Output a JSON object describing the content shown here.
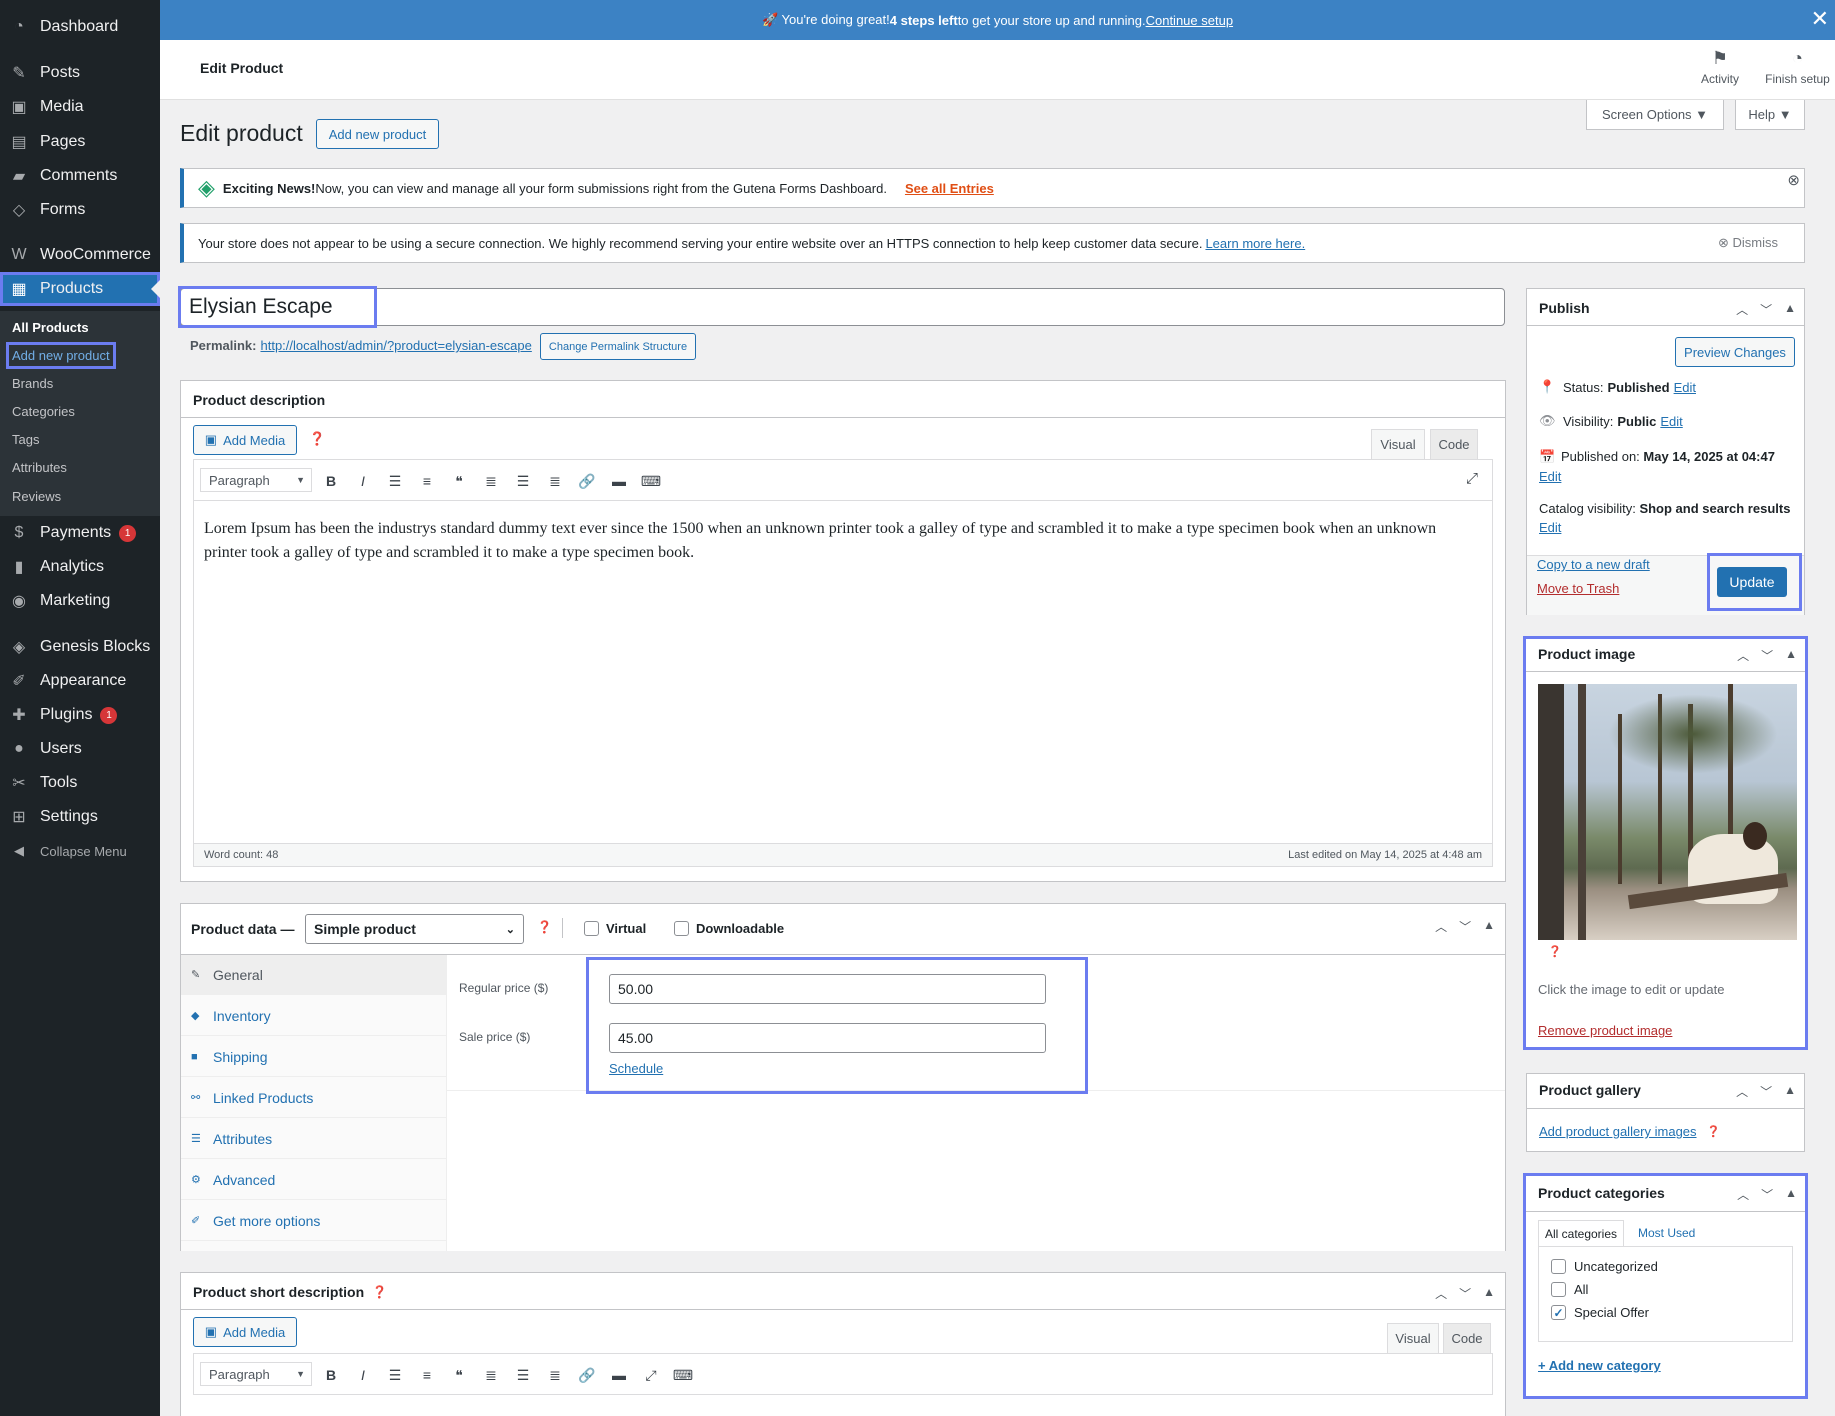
{
  "banner": {
    "text_a": "🚀 You're doing great! ",
    "strong": "4 steps left",
    "text_b": " to get your store up and running. ",
    "link": "Continue setup"
  },
  "sidebar": {
    "items": [
      {
        "label": "Dashboard",
        "icon": "dashboard-icon",
        "glyph": "◔"
      },
      {
        "label": "Posts",
        "icon": "pin-icon",
        "glyph": "✎"
      },
      {
        "label": "Media",
        "icon": "media-icon",
        "glyph": "▣"
      },
      {
        "label": "Pages",
        "icon": "pages-icon",
        "glyph": "▤"
      },
      {
        "label": "Comments",
        "icon": "comments-icon",
        "glyph": "▰"
      },
      {
        "label": "Forms",
        "icon": "forms-icon",
        "glyph": "◇"
      },
      {
        "label": "WooCommerce",
        "icon": "woo-icon",
        "glyph": "W"
      },
      {
        "label": "Products",
        "icon": "products-icon",
        "glyph": "▦"
      },
      {
        "label": "Payments",
        "icon": "payments-icon",
        "glyph": "$",
        "badge": "1"
      },
      {
        "label": "Analytics",
        "icon": "analytics-icon",
        "glyph": "▮"
      },
      {
        "label": "Marketing",
        "icon": "marketing-icon",
        "glyph": "◉"
      },
      {
        "label": "Genesis Blocks",
        "icon": "genesis-icon",
        "glyph": "◈"
      },
      {
        "label": "Appearance",
        "icon": "appearance-icon",
        "glyph": "✐"
      },
      {
        "label": "Plugins",
        "icon": "plugins-icon",
        "glyph": "✚",
        "badge": "1"
      },
      {
        "label": "Users",
        "icon": "users-icon",
        "glyph": "●"
      },
      {
        "label": "Tools",
        "icon": "tools-icon",
        "glyph": "✂"
      },
      {
        "label": "Settings",
        "icon": "settings-icon",
        "glyph": "⊞"
      },
      {
        "label": "Collapse Menu",
        "icon": "collapse-icon",
        "glyph": "◀"
      }
    ],
    "sub": [
      "All Products",
      "Add new product",
      "Brands",
      "Categories",
      "Tags",
      "Attributes",
      "Reviews"
    ]
  },
  "header": {
    "title": "Edit Product",
    "activity": "Activity",
    "finish": "Finish setup"
  },
  "page": {
    "title": "Edit product",
    "add_new": "Add new product",
    "screen_options": "Screen Options ▼",
    "help": "Help ▼"
  },
  "notice1": {
    "strong": "Exciting News!",
    "text": " Now, you can view and manage all your form submissions right from the Gutena Forms Dashboard.",
    "link": "See all Entries"
  },
  "notice2": {
    "text": "Your store does not appear to be using a secure connection. We highly recommend serving your entire website over an HTTPS connection to help keep customer data secure. ",
    "link": "Learn more here.",
    "dismiss": "Dismiss"
  },
  "product": {
    "title": "Elysian Escape",
    "permalink_label": "Permalink:",
    "permalink": "http://localhost/admin/?product=elysian-escape",
    "change_permalink": "Change Permalink Structure"
  },
  "description": {
    "heading": "Product description",
    "add_media": "Add Media",
    "visual": "Visual",
    "code": "Code",
    "format": "Paragraph",
    "text": "Lorem Ipsum has been the industrys standard dummy text ever since the 1500 when an unknown printer took a galley of type and scrambled it to make a type specimen book when an unknown printer took a galley of type and scrambled it to make a type specimen book.",
    "word_count": "Word count: 48",
    "last_edited": "Last edited on May 14, 2025 at 4:48 am"
  },
  "product_data": {
    "heading": "Product data —",
    "type": "Simple product",
    "virtual": "Virtual",
    "downloadable": "Downloadable",
    "tabs": [
      {
        "label": "General",
        "glyph": "✎"
      },
      {
        "label": "Inventory",
        "glyph": "◆"
      },
      {
        "label": "Shipping",
        "glyph": "■"
      },
      {
        "label": "Linked Products",
        "glyph": "⚯"
      },
      {
        "label": "Attributes",
        "glyph": "☰"
      },
      {
        "label": "Advanced",
        "glyph": "⚙"
      },
      {
        "label": "Get more options",
        "glyph": "✐"
      }
    ],
    "regular_label": "Regular price ($)",
    "regular": "50.00",
    "sale_label": "Sale price ($)",
    "sale": "45.00",
    "schedule": "Schedule"
  },
  "short_desc": {
    "heading": "Product short description",
    "add_media": "Add Media",
    "visual": "Visual",
    "code": "Code",
    "format": "Paragraph"
  },
  "publish": {
    "heading": "Publish",
    "preview": "Preview Changes",
    "status_label": "Status: ",
    "status": "Published",
    "visibility_label": "Visibility: ",
    "visibility": "Public",
    "published_label": "Published on: ",
    "published": "May 14, 2025 at 04:47",
    "catalog_label": "Catalog visibility: ",
    "catalog": "Shop and search results",
    "edit": "Edit",
    "copy": "Copy to a new draft",
    "trash": "Move to Trash",
    "update": "Update"
  },
  "product_image": {
    "heading": "Product image",
    "hint": "Click the image to edit or update",
    "remove": "Remove product image"
  },
  "gallery": {
    "heading": "Product gallery",
    "add": "Add product gallery images"
  },
  "categories": {
    "heading": "Product categories",
    "tab_all": "All categories",
    "tab_most": "Most Used",
    "items": [
      {
        "label": "Uncategorized",
        "checked": false
      },
      {
        "label": "All",
        "checked": false
      },
      {
        "label": "Special Offer",
        "checked": true
      }
    ],
    "add": "+ Add new category"
  }
}
